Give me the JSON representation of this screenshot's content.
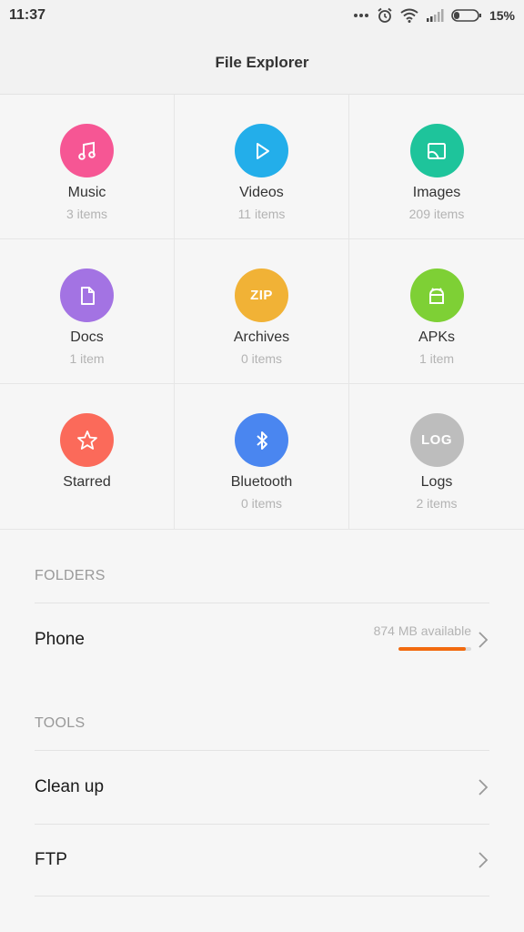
{
  "status": {
    "time": "11:37",
    "battery": "15%"
  },
  "app": {
    "title": "File Explorer"
  },
  "categories": [
    {
      "label": "Music",
      "count": "3 items",
      "color": "#f65694",
      "icon": "music-icon"
    },
    {
      "label": "Videos",
      "count": "11 items",
      "color": "#23aeea",
      "icon": "play-icon"
    },
    {
      "label": "Images",
      "count": "209 items",
      "color": "#1ec49b",
      "icon": "image-icon"
    },
    {
      "label": "Docs",
      "count": "1 item",
      "color": "#a373e3",
      "icon": "document-icon"
    },
    {
      "label": "Archives",
      "count": "0 items",
      "color": "#f1b236",
      "icon": "zip-icon",
      "icon_text": "ZIP"
    },
    {
      "label": "APKs",
      "count": "1 item",
      "color": "#7ed035",
      "icon": "android-icon"
    },
    {
      "label": "Starred",
      "count": "",
      "color": "#fb6a5a",
      "icon": "star-icon"
    },
    {
      "label": "Bluetooth",
      "count": "0 items",
      "color": "#4a86f0",
      "icon": "bluetooth-icon"
    },
    {
      "label": "Logs",
      "count": "2 items",
      "color": "#bdbdbd",
      "icon": "log-icon",
      "icon_text": "LOG"
    }
  ],
  "folders": {
    "header": "FOLDERS",
    "phone": {
      "label": "Phone",
      "available": "874 MB available",
      "used_fraction": 0.93,
      "bar_color": "#f26a0f"
    }
  },
  "tools": {
    "header": "TOOLS",
    "items": [
      {
        "label": "Clean up"
      },
      {
        "label": "FTP"
      }
    ]
  }
}
